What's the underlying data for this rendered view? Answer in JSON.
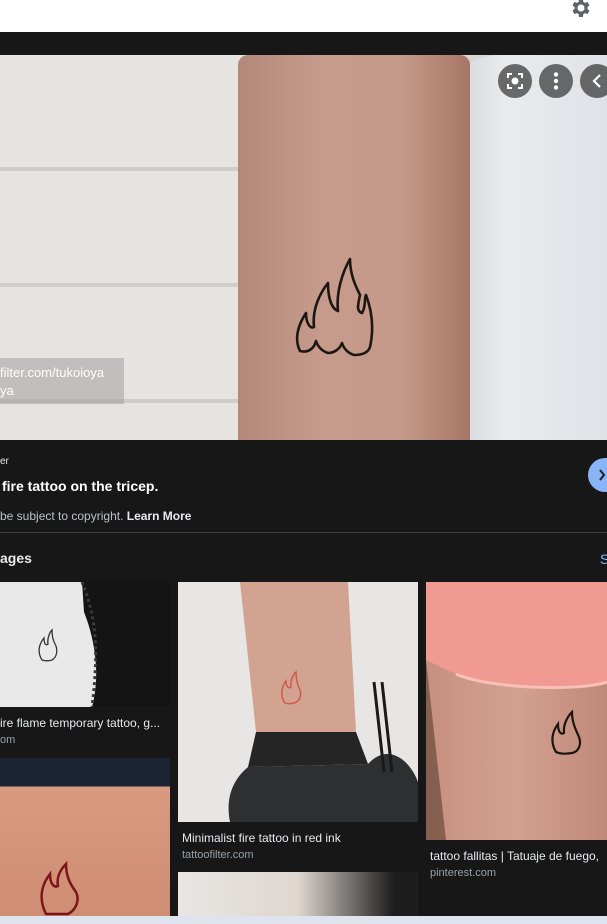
{
  "icons": {
    "settings": "gear-icon",
    "lens": "lens-icon",
    "more": "more-vert-icon",
    "back": "chevron-left-icon",
    "visit": "visit-icon"
  },
  "colors": {
    "background": "#171717",
    "accent": "#8ab4f8",
    "tattoo_red": "#d05a4f"
  },
  "preview": {
    "watermark_line1": "filter.com/tukoioya",
    "watermark_line2": "ya"
  },
  "meta": {
    "source": "er",
    "title": "fire tattoo on the tricep.",
    "copyright": "be subject to copyright.",
    "learn_more": "Learn More"
  },
  "related": {
    "heading": "ages",
    "see_more": "S",
    "cards": [
      {
        "title": "ire flame temporary tattoo, g...",
        "source": "om"
      },
      {
        "title": "Minimalist fire tattoo in red ink",
        "source": "tattoofilter.com"
      },
      {
        "title": "tattoo fallitas | Tatuaje de fuego,",
        "source": "pinterest.com"
      }
    ]
  }
}
